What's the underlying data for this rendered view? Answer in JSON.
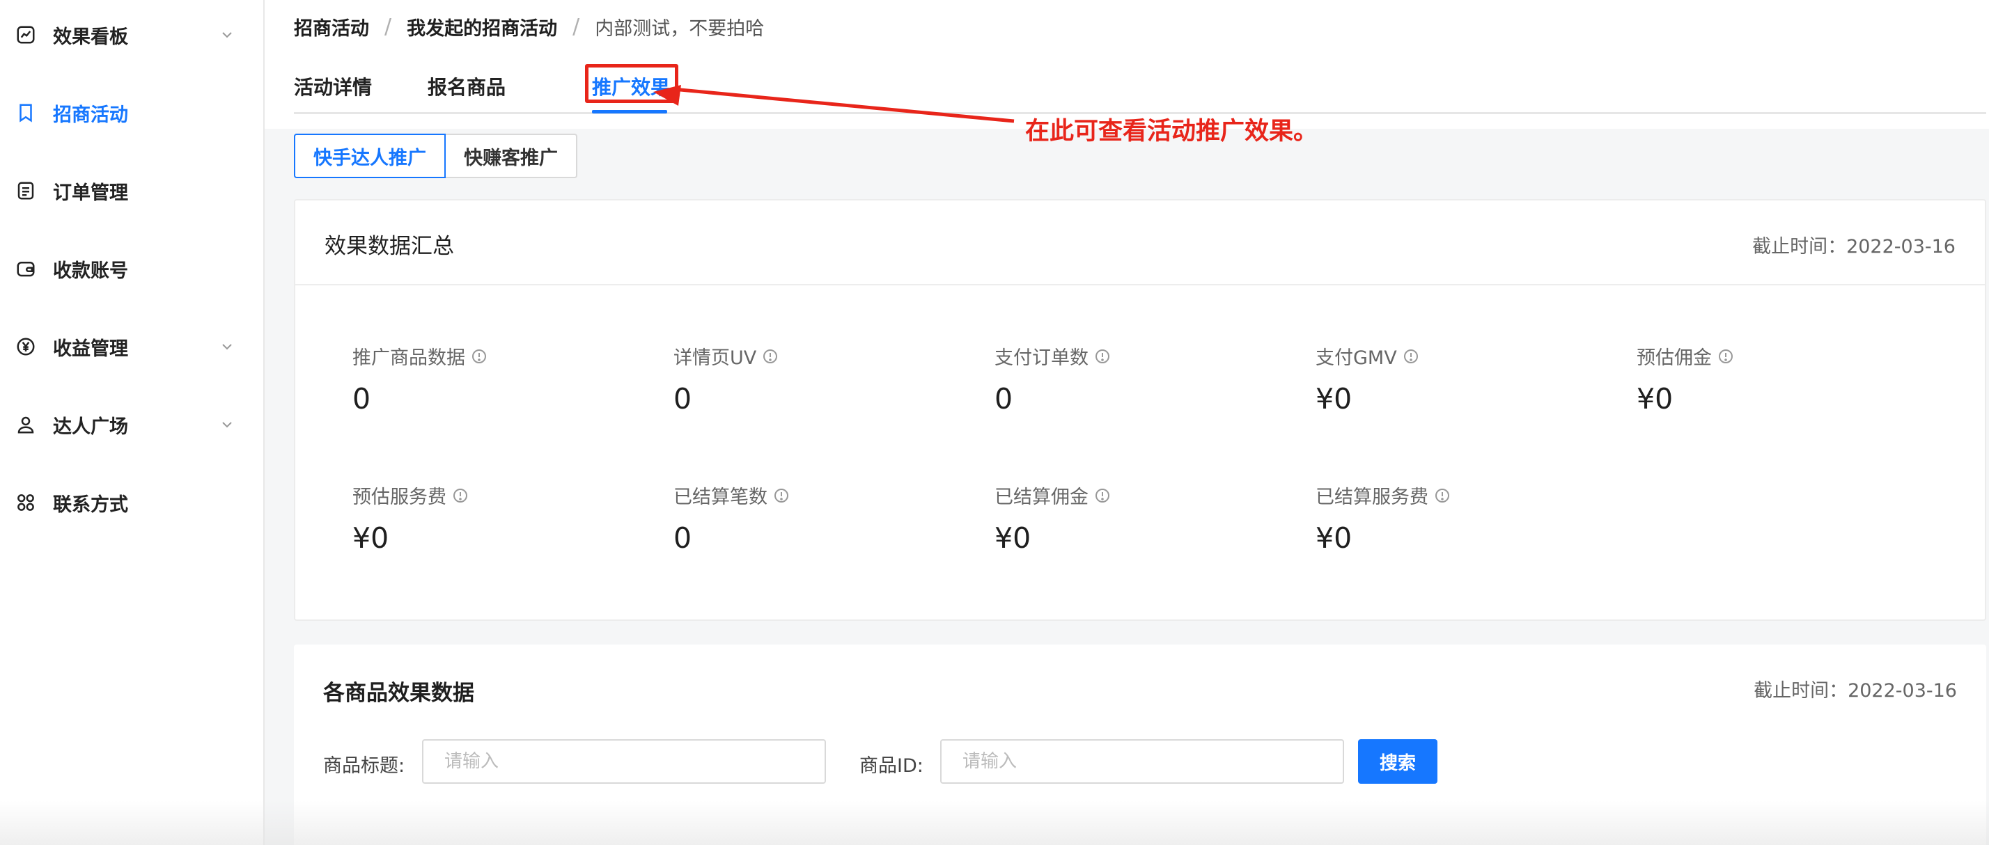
{
  "sidebar": {
    "items": [
      {
        "label": "效果看板",
        "icon": "chart-icon",
        "active": false,
        "expandable": true
      },
      {
        "label": "招商活动",
        "icon": "bookmark-icon",
        "active": true,
        "expandable": false
      },
      {
        "label": "订单管理",
        "icon": "order-list-icon",
        "active": false,
        "expandable": false
      },
      {
        "label": "收款账号",
        "icon": "wallet-icon",
        "active": false,
        "expandable": false
      },
      {
        "label": "收益管理",
        "icon": "yuan-icon",
        "active": false,
        "expandable": true
      },
      {
        "label": "达人广场",
        "icon": "user-icon",
        "active": false,
        "expandable": true
      },
      {
        "label": "联系方式",
        "icon": "grid-icon",
        "active": false,
        "expandable": false
      }
    ]
  },
  "breadcrumb": {
    "items": [
      "招商活动",
      "我发起的招商活动",
      "内部测试，不要拍哈"
    ],
    "separator": "/"
  },
  "tabs": [
    {
      "label": "活动详情",
      "active": false
    },
    {
      "label": "报名商品",
      "active": false
    },
    {
      "label": "推广效果",
      "active": true
    }
  ],
  "annotation": {
    "text": "在此可查看活动推广效果。",
    "color": "#e8251a"
  },
  "segment": {
    "options": [
      "快手达人推广",
      "快赚客推广"
    ],
    "selected": "快手达人推广"
  },
  "summary": {
    "title": "效果数据汇总",
    "date": "截止时间：2022-03-16",
    "metrics": [
      {
        "label": "推广商品数据",
        "value": "0"
      },
      {
        "label": "详情页UV",
        "value": "0"
      },
      {
        "label": "支付订单数",
        "value": "0"
      },
      {
        "label": "支付GMV",
        "value": "¥0"
      },
      {
        "label": "预估佣金",
        "value": "¥0"
      },
      {
        "label": "预估服务费",
        "value": "¥0"
      },
      {
        "label": "已结算笔数",
        "value": "0"
      },
      {
        "label": "已结算佣金",
        "value": "¥0"
      },
      {
        "label": "已结算服务费",
        "value": "¥0"
      }
    ]
  },
  "product_data": {
    "title": "各商品效果数据",
    "date": "截止时间：2022-03-16",
    "filters": {
      "title_label": "商品标题:",
      "title_placeholder": "请输入",
      "id_label": "商品ID:",
      "id_placeholder": "请输入",
      "search_label": "搜索"
    }
  },
  "colors": {
    "accent": "#1677ff",
    "annotation": "#e8251a"
  }
}
